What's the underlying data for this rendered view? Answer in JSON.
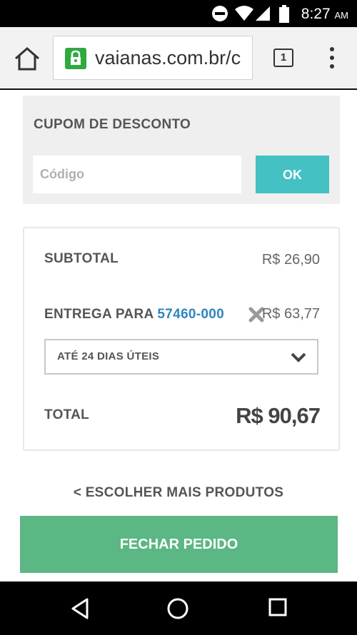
{
  "status_bar": {
    "time": "8:27",
    "ampm": "AM",
    "icons": [
      "do-not-disturb-icon",
      "wifi-icon",
      "signal-icon",
      "battery-icon"
    ]
  },
  "browser": {
    "url": "vaianas.com.br/c",
    "tab_count": "1",
    "icons": [
      "home-icon",
      "lock-icon",
      "tabs-icon",
      "overflow-menu-icon"
    ],
    "lock_color": "#2eaa3f"
  },
  "coupon": {
    "title": "CUPOM DE DESCONTO",
    "placeholder": "Código",
    "value": "",
    "button_label": "OK",
    "button_color": "#43c1c3"
  },
  "summary": {
    "subtotal_label": "SUBTOTAL",
    "subtotal_value": "R$ 26,90",
    "shipping_label": "ENTREGA PARA",
    "shipping_cep": "57460-000",
    "shipping_value": "R$ 63,77",
    "shipping_option": "ATÉ 24 DIAS ÚTEIS",
    "total_label": "TOTAL",
    "total_value": "R$ 90,67"
  },
  "actions": {
    "more_products": "< ESCOLHER MAIS PRODUTOS",
    "checkout": "FECHAR PEDIDO",
    "checkout_color": "#5bb783"
  },
  "nav_bar": {
    "icons": [
      "back-icon",
      "home-circle-icon",
      "recents-icon"
    ]
  }
}
